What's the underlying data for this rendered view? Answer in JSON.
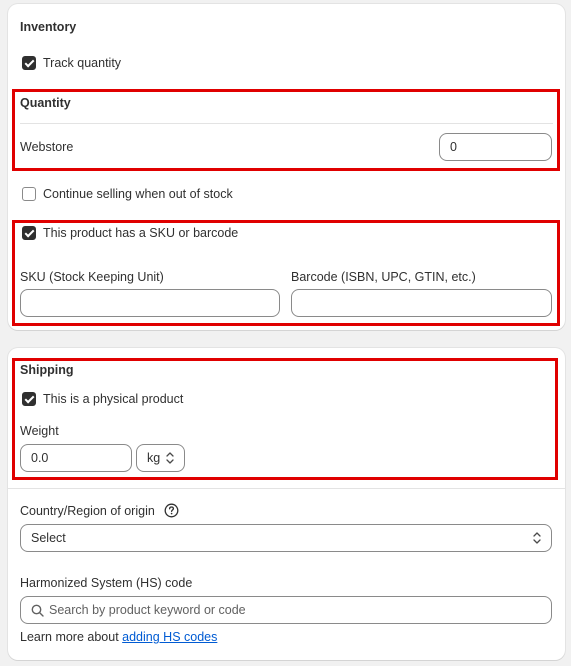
{
  "inventory": {
    "title": "Inventory",
    "track_quantity": {
      "label": "Track quantity",
      "checked": true
    },
    "quantity": {
      "title": "Quantity",
      "location_label": "Webstore",
      "value": "0"
    },
    "continue_selling": {
      "label": "Continue selling when out of stock",
      "checked": false
    },
    "sku_barcode": {
      "label": "This product has a SKU or barcode",
      "checked": true,
      "sku_label": "SKU (Stock Keeping Unit)",
      "sku_value": "",
      "barcode_label": "Barcode (ISBN, UPC, GTIN, etc.)",
      "barcode_value": ""
    }
  },
  "shipping": {
    "title": "Shipping",
    "physical_product": {
      "label": "This is a physical product",
      "checked": true
    },
    "weight": {
      "label": "Weight",
      "value": "0.0",
      "unit": "kg"
    },
    "country_origin": {
      "label": "Country/Region of origin",
      "help_icon": "question-circle-icon",
      "selected": "Select"
    },
    "hs_code": {
      "label": "Harmonized System (HS) code",
      "placeholder": "Search by product keyword or code",
      "learn_more_prefix": "Learn more about ",
      "learn_more_link": "adding HS codes"
    }
  },
  "colors": {
    "highlight": "#e00000",
    "link": "#005bd3",
    "checkbox_checked": "#303030"
  }
}
